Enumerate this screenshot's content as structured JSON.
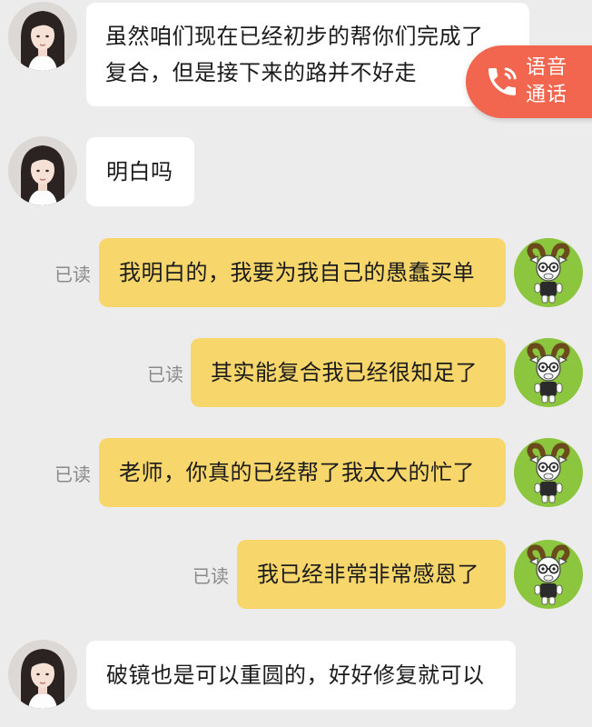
{
  "messages": [
    {
      "side": "in",
      "lines": [
        "虽然咱们现在已经初步的帮你们完成了",
        "复合，但是接下来的路并不好走"
      ]
    },
    {
      "side": "in",
      "text": "明白吗"
    },
    {
      "side": "out",
      "read": "已读",
      "text": "我明白的，我要为我自己的愚蠢买单"
    },
    {
      "side": "out",
      "read": "已读",
      "text": "其实能复合我已经很知足了"
    },
    {
      "side": "out",
      "read": "已读",
      "text": "老师，你真的已经帮了我太大的忙了"
    },
    {
      "side": "out",
      "read": "已读",
      "text": "我已经非常非常感恩了"
    },
    {
      "side": "in",
      "text": "破镜也是可以重圆的，好好修复就可以"
    }
  ],
  "voice_call": {
    "line1": "语音",
    "line2": "通话",
    "icon": "phone-icon"
  },
  "avatars": {
    "contact": "woman-portrait-avatar",
    "self": "goat-cartoon-avatar"
  },
  "colors": {
    "background": "#ececec",
    "incoming_bubble": "#ffffff",
    "outgoing_bubble": "#f7d66b",
    "accent": "#f2654e"
  }
}
